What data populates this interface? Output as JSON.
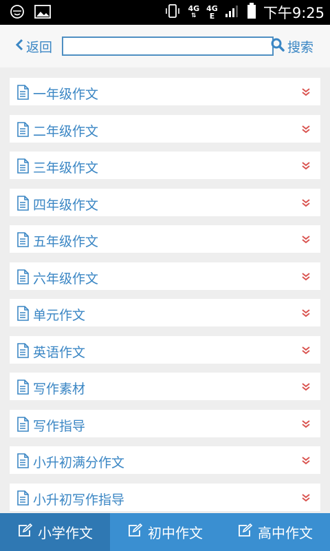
{
  "status_bar": {
    "network_top": "4G",
    "network_right_top": "4G",
    "network_right_bottom": "E",
    "time": "下午9:25"
  },
  "header": {
    "back_label": "返回",
    "search_value": "",
    "search_label": "搜索"
  },
  "list": {
    "items": [
      {
        "label": "一年级作文"
      },
      {
        "label": "二年级作文"
      },
      {
        "label": "三年级作文"
      },
      {
        "label": "四年级作文"
      },
      {
        "label": "五年级作文"
      },
      {
        "label": "六年级作文"
      },
      {
        "label": "单元作文"
      },
      {
        "label": "英语作文"
      },
      {
        "label": "写作素材"
      },
      {
        "label": "写作指导"
      },
      {
        "label": "小升初满分作文"
      },
      {
        "label": "小升初写作指导"
      }
    ]
  },
  "tabs": [
    {
      "label": "小学作文",
      "active": true
    },
    {
      "label": "初中作文",
      "active": false
    },
    {
      "label": "高中作文",
      "active": false
    }
  ],
  "colors": {
    "accent": "#3a86c4",
    "chevron": "#d9534f",
    "tabbar": "#3a8fd1",
    "tab_active": "#2f78b3"
  },
  "icons": {
    "item": "document-icon",
    "item_expand": "chevron-double-down-icon",
    "tab": "edit-icon",
    "back": "chevron-left-icon",
    "search": "search-icon"
  }
}
